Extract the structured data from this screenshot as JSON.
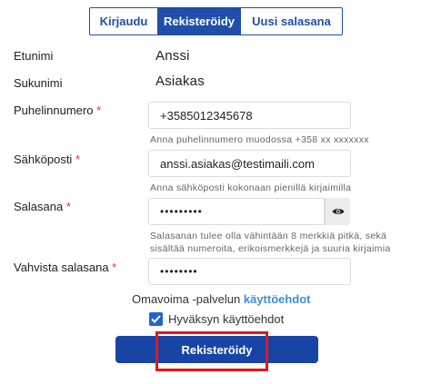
{
  "tabs": [
    {
      "label": "Kirjaudu",
      "active": false
    },
    {
      "label": "Rekisteröidy",
      "active": true
    },
    {
      "label": "Uusi salasana",
      "active": false
    }
  ],
  "form": {
    "first_name": {
      "label": "Etunimi",
      "value": "Anssi"
    },
    "last_name": {
      "label": "Sukunimi",
      "value": "Asiakas"
    },
    "phone": {
      "label": "Puhelinnumero",
      "required_mark": "*",
      "value": "+3585012345678",
      "helper": "Anna puhelinnumero muodossa +358 xx xxxxxxx"
    },
    "email": {
      "label": "Sähköposti",
      "required_mark": "*",
      "value": "anssi.asiakas@testimaili.com",
      "helper": "Anna sähköposti kokonaan pienillä kirjaimilla"
    },
    "password": {
      "label": "Salasana",
      "required_mark": "*",
      "value": "•••••••••",
      "helper_line1": "Salasanan tulee olla vähintään 8 merkkiä pitkä, sekä",
      "helper_line2": "sisältää numeroita, erikoismerkkejä ja suuria kirjaimia",
      "toggle_icon": "eye-icon"
    },
    "confirm_password": {
      "label": "Vahvista salasana",
      "required_mark": "*",
      "value": "••••••••"
    }
  },
  "terms": {
    "text": "Omavoima -palvelun",
    "link": "käyttöehdot"
  },
  "accept": {
    "label": "Hyväksyn käyttöehdot",
    "checked": true
  },
  "submit": {
    "label": "Rekisteröidy"
  },
  "colors": {
    "primary": "#1845a5",
    "link": "#3f8fd6",
    "required": "#d33333",
    "highlight": "#e41818"
  }
}
